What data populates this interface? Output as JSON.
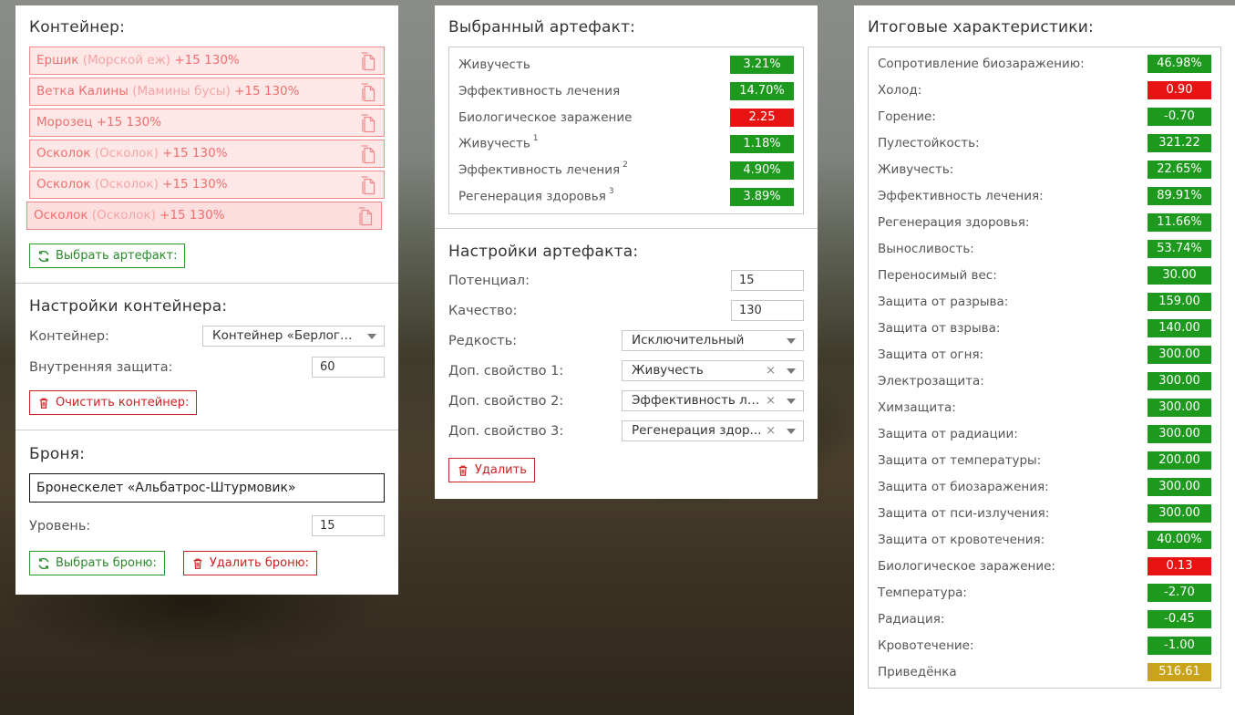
{
  "container_panel": {
    "title": "Контейнер:",
    "items": [
      {
        "name": "Ершик",
        "sub": "(Морской еж)",
        "suffix": "+15 130%"
      },
      {
        "name": "Ветка Калины",
        "sub": "(Мамины бусы)",
        "suffix": "+15 130%"
      },
      {
        "name": "Морозец",
        "sub": "",
        "suffix": "+15 130%"
      },
      {
        "name": "Осколок",
        "sub": "(Осколок)",
        "suffix": "+15 130%"
      },
      {
        "name": "Осколок",
        "sub": "(Осколок)",
        "suffix": "+15 130%"
      },
      {
        "name": "Осколок",
        "sub": "(Осколок)",
        "suffix": "+15 130%"
      }
    ],
    "choose_button": "Выбрать артефакт:"
  },
  "container_settings": {
    "title": "Настройки контейнера:",
    "container_label": "Контейнер:",
    "container_value": "Контейнер «Берлога...",
    "protection_label": "Внутренняя защита:",
    "protection_value": "60",
    "clear_button": "Очистить контейнер:"
  },
  "armor": {
    "title": "Броня:",
    "value": "Бронескелет «Альбатрос-Штурмовик»",
    "level_label": "Уровень:",
    "level_value": "15",
    "choose_button": "Выбрать броню:",
    "delete_button": "Удалить броню:"
  },
  "selected_artifact": {
    "title": "Выбранный артефакт:",
    "stats": [
      {
        "label": "Живучесть",
        "sup": "",
        "value": "3.21%",
        "color": "g"
      },
      {
        "label": "Эффективность лечения",
        "sup": "",
        "value": "14.70%",
        "color": "g"
      },
      {
        "label": "Биологическое заражение",
        "sup": "",
        "value": "2.25",
        "color": "r"
      },
      {
        "label": "Живучесть",
        "sup": "1",
        "value": "1.18%",
        "color": "g"
      },
      {
        "label": "Эффективность лечения",
        "sup": "2",
        "value": "4.90%",
        "color": "g"
      },
      {
        "label": "Регенерация здоровья",
        "sup": "3",
        "value": "3.89%",
        "color": "g"
      }
    ]
  },
  "artifact_settings": {
    "title": "Настройки артефакта:",
    "potential_label": "Потенциал:",
    "potential_value": "15",
    "quality_label": "Качество:",
    "quality_value": "130",
    "rarity_label": "Редкость:",
    "rarity_value": "Исключительный",
    "prop1_label": "Доп. свойство 1:",
    "prop1_value": "Живучесть",
    "prop2_label": "Доп. свойство 2:",
    "prop2_value": "Эффективность ле...",
    "prop3_label": "Доп. свойство 3:",
    "prop3_value": "Регенерация здор...",
    "clear_symbol": "×",
    "delete_button": "Удалить"
  },
  "totals": {
    "title": "Итоговые характеристики:",
    "stats": [
      {
        "label": "Сопротивление биозаражению:",
        "value": "46.98%",
        "color": "g"
      },
      {
        "label": "Холод:",
        "value": "0.90",
        "color": "r"
      },
      {
        "label": "Горение:",
        "value": "-0.70",
        "color": "g"
      },
      {
        "label": "Пулестойкость:",
        "value": "321.22",
        "color": "g"
      },
      {
        "label": "Живучесть:",
        "value": "22.65%",
        "color": "g"
      },
      {
        "label": "Эффективность лечения:",
        "value": "89.91%",
        "color": "g"
      },
      {
        "label": "Регенерация здоровья:",
        "value": "11.66%",
        "color": "g"
      },
      {
        "label": "Выносливость:",
        "value": "53.74%",
        "color": "g"
      },
      {
        "label": "Переносимый вес:",
        "value": "30.00",
        "color": "g"
      },
      {
        "label": "Защита от разрыва:",
        "value": "159.00",
        "color": "g"
      },
      {
        "label": "Защита от взрыва:",
        "value": "140.00",
        "color": "g"
      },
      {
        "label": "Защита от огня:",
        "value": "300.00",
        "color": "g"
      },
      {
        "label": "Электрозащита:",
        "value": "300.00",
        "color": "g"
      },
      {
        "label": "Химзащита:",
        "value": "300.00",
        "color": "g"
      },
      {
        "label": "Защита от радиации:",
        "value": "300.00",
        "color": "g"
      },
      {
        "label": "Защита от температуры:",
        "value": "200.00",
        "color": "g"
      },
      {
        "label": "Защита от биозаражения:",
        "value": "300.00",
        "color": "g"
      },
      {
        "label": "Защита от пси-излучения:",
        "value": "300.00",
        "color": "g"
      },
      {
        "label": "Защита от кровотечения:",
        "value": "40.00%",
        "color": "g"
      },
      {
        "label": "Биологическое заражение:",
        "value": "0.13",
        "color": "r"
      },
      {
        "label": "Температура:",
        "value": "-2.70",
        "color": "g"
      },
      {
        "label": "Радиация:",
        "value": "-0.45",
        "color": "g"
      },
      {
        "label": "Кровотечение:",
        "value": "-1.00",
        "color": "g"
      },
      {
        "label": "Приведёнка",
        "value": "516.61",
        "color": "y"
      }
    ]
  }
}
